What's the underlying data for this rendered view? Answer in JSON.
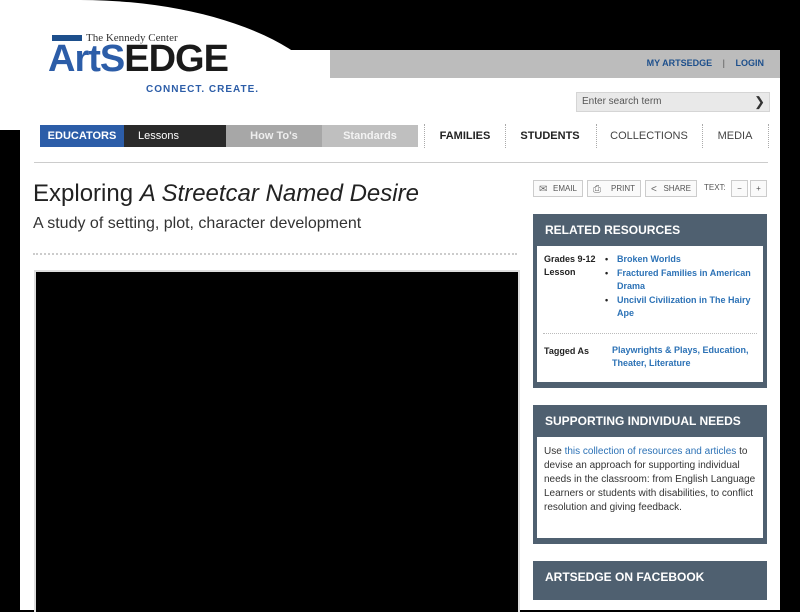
{
  "site": {
    "org": "The Kennedy Center",
    "logo_arts": "ArtS",
    "logo_edge": "EDGE",
    "tagline": "CONNECT. CREATE."
  },
  "header_links": {
    "my_artsedge": "MY ARTSEDGE",
    "separator": "|",
    "login": "LOGIN"
  },
  "search": {
    "placeholder": "Enter search term"
  },
  "nav": {
    "educators": "EDUCATORS",
    "lessons": "Lessons",
    "how_tos": "How To's",
    "standards": "Standards",
    "families": "FAMILIES",
    "students": "STUDENTS",
    "collections": "COLLECTIONS",
    "media": "MEDIA"
  },
  "article": {
    "title_prefix": "Exploring ",
    "title_italic": "A Streetcar Named Desire",
    "subtitle": "A study of setting, plot, character development"
  },
  "tools": {
    "email": "EMAIL",
    "print": "PRINT",
    "share": "SHARE",
    "text_label": "TEXT:",
    "minus": "−",
    "plus": "+"
  },
  "related": {
    "heading": "RELATED RESOURCES",
    "grade_label": "Grades 9-12",
    "type_label": "Lesson",
    "items": [
      "Broken Worlds",
      "Fractured Families in American Drama",
      "Uncivil Civilization in The Hairy Ape"
    ],
    "tagged_label": "Tagged As",
    "tags": "Playwrights & Plays, Education, Theater, Literature"
  },
  "support": {
    "heading": "SUPPORTING INDIVIDUAL NEEDS",
    "text_before": "Use ",
    "link": "this collection of resources and articles",
    "text_after": " to devise an approach for supporting individual needs in the classroom: from English Language Learners or students with disabilities, to conflict resolution and giving feedback."
  },
  "facebook": {
    "heading": "ARTSEDGE ON FACEBOOK"
  },
  "icons": {
    "email": "envelope-icon",
    "print": "printer-icon",
    "share": "share-icon",
    "search": "arrow-right-icon"
  }
}
